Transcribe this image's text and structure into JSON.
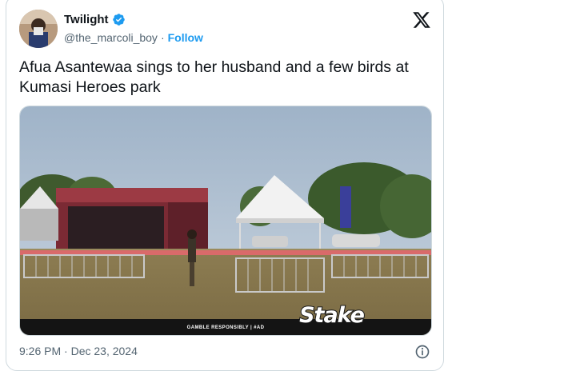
{
  "author": {
    "display_name": "Twilight",
    "handle": "@the_marcoli_boy",
    "separator": "·",
    "follow_label": "Follow"
  },
  "tweet": {
    "text": "Afua Asantewaa sings to her husband and a few birds at Kumasi Heroes park",
    "timestamp": "9:26 PM · Dec 23, 2024"
  },
  "media": {
    "banner_text": "GAMBLE RESPONSIBLY  |  #AD",
    "brand_logo_text": "Stake"
  },
  "icons": {
    "verified": "verified-badge-icon",
    "x_logo": "x-logo-icon",
    "info": "info-icon"
  },
  "colors": {
    "accent": "#1d9bf0",
    "secondary_text": "#536471",
    "border": "#cfd9de"
  }
}
